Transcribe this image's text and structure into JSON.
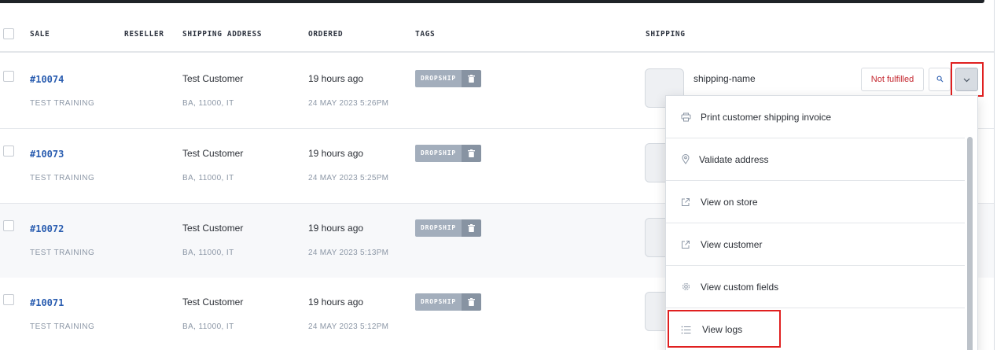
{
  "table": {
    "headers": {
      "sale": "SALE",
      "reseller": "RESELLER",
      "shipping_address": "SHIPPING ADDRESS",
      "ordered": "ORDERED",
      "tags": "TAGS",
      "shipping": "SHIPPING"
    },
    "rows": [
      {
        "sale": "#10074",
        "store": "TEST TRAINING",
        "customer": "Test Customer",
        "address": "BA, 11000, IT",
        "ordered_ago": "19 hours ago",
        "ordered_date": "24 MAY 2023 5:26PM",
        "tag": "DROPSHIP",
        "shipping_name": "shipping-name"
      },
      {
        "sale": "#10073",
        "store": "TEST TRAINING",
        "customer": "Test Customer",
        "address": "BA, 11000, IT",
        "ordered_ago": "19 hours ago",
        "ordered_date": "24 MAY 2023 5:25PM",
        "tag": "DROPSHIP"
      },
      {
        "sale": "#10072",
        "store": "TEST TRAINING",
        "customer": "Test Customer",
        "address": "BA, 11000, IT",
        "ordered_ago": "19 hours ago",
        "ordered_date": "24 MAY 2023 5:13PM",
        "tag": "DROPSHIP"
      },
      {
        "sale": "#10071",
        "store": "TEST TRAINING",
        "customer": "Test Customer",
        "address": "BA, 11000, IT",
        "ordered_ago": "19 hours ago",
        "ordered_date": "24 MAY 2023 5:12PM",
        "tag": "DROPSHIP"
      }
    ]
  },
  "actions": {
    "fulfillment_status": "Not fulfilled",
    "status_color": "#c4262e",
    "search_icon": "search-icon",
    "caret_icon": "chevron-down-icon"
  },
  "dropdown": {
    "items": [
      {
        "label": "Print customer shipping invoice",
        "icon": "printer-icon"
      },
      {
        "label": "Validate address",
        "icon": "map-pin-icon"
      },
      {
        "label": "View on store",
        "icon": "external-link-icon"
      },
      {
        "label": "View customer",
        "icon": "external-link-icon"
      },
      {
        "label": "View custom fields",
        "icon": "gear-icon"
      },
      {
        "label": "View logs",
        "icon": "list-icon"
      }
    ]
  },
  "colors": {
    "link": "#2a5db0",
    "highlight": "#e02020",
    "tag_bg": "#a3aebc"
  }
}
